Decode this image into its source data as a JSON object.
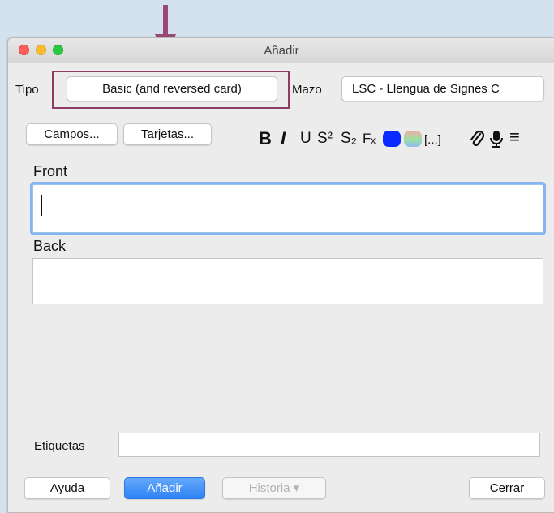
{
  "window": {
    "title": "Añadir"
  },
  "top": {
    "tipo_label": "Tipo",
    "note_type": "Basic (and reversed card)",
    "mazo_label": "Mazo",
    "deck": "LSC - Llengua de Signes C"
  },
  "toolbar": {
    "fields_button": "Campos...",
    "cards_button": "Tarjetas...",
    "bold": "B",
    "italic": "I",
    "underline": "U",
    "superscript": "S²",
    "subscript": "S₂",
    "clear_format": "Fₓ",
    "cloze": "[...]",
    "attach": "🔗",
    "record": "🎙",
    "more": "≡",
    "text_color": "#0a2bff"
  },
  "fields": [
    {
      "name": "Front",
      "value": ""
    },
    {
      "name": "Back",
      "value": ""
    }
  ],
  "tags": {
    "label": "Etiquetas",
    "value": ""
  },
  "footer": {
    "help": "Ayuda",
    "add": "Añadir",
    "history": "Historia ▾",
    "close": "Cerrar"
  },
  "annotation": {
    "color": "#9b4a72"
  }
}
